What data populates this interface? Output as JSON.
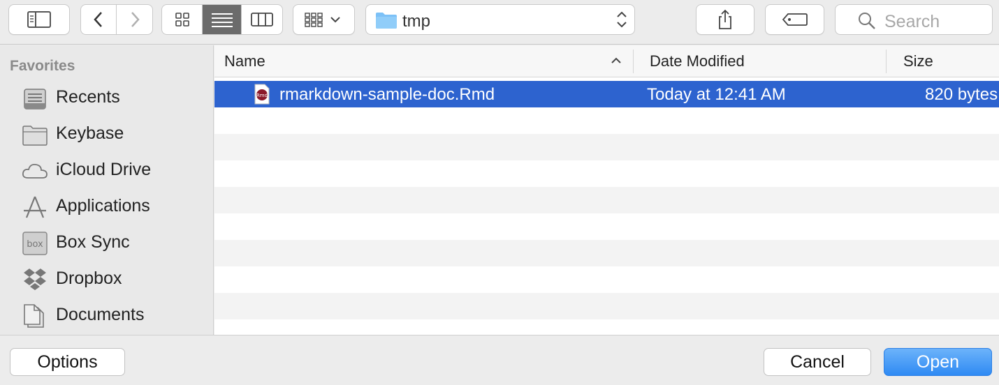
{
  "toolbar": {
    "view_modes": [
      "icon-view",
      "list-view",
      "column-view"
    ],
    "active_view": "list-view",
    "path": {
      "current_folder": "tmp"
    },
    "search": {
      "placeholder": "Search"
    }
  },
  "sidebar": {
    "header": "Favorites",
    "items": [
      {
        "label": "Recents",
        "icon": "recents-icon"
      },
      {
        "label": "Keybase",
        "icon": "folder-icon"
      },
      {
        "label": "iCloud Drive",
        "icon": "cloud-icon"
      },
      {
        "label": "Applications",
        "icon": "applications-icon"
      },
      {
        "label": "Box Sync",
        "icon": "box-icon"
      },
      {
        "label": "Dropbox",
        "icon": "dropbox-icon"
      },
      {
        "label": "Documents",
        "icon": "documents-icon"
      }
    ]
  },
  "file_list": {
    "columns": [
      "Name",
      "Date Modified",
      "Size"
    ],
    "sort_column": "Name",
    "rows": [
      {
        "name": "rmarkdown-sample-doc.Rmd",
        "date_modified": "Today at 12:41 AM",
        "size": "820 bytes",
        "selected": true,
        "icon_label": "Rmd"
      }
    ]
  },
  "footer": {
    "options_label": "Options",
    "cancel_label": "Cancel",
    "open_label": "Open"
  },
  "colors": {
    "selection": "#2d63cf",
    "primary_button": "#2f8af3",
    "folder": "#7cc1f7"
  }
}
